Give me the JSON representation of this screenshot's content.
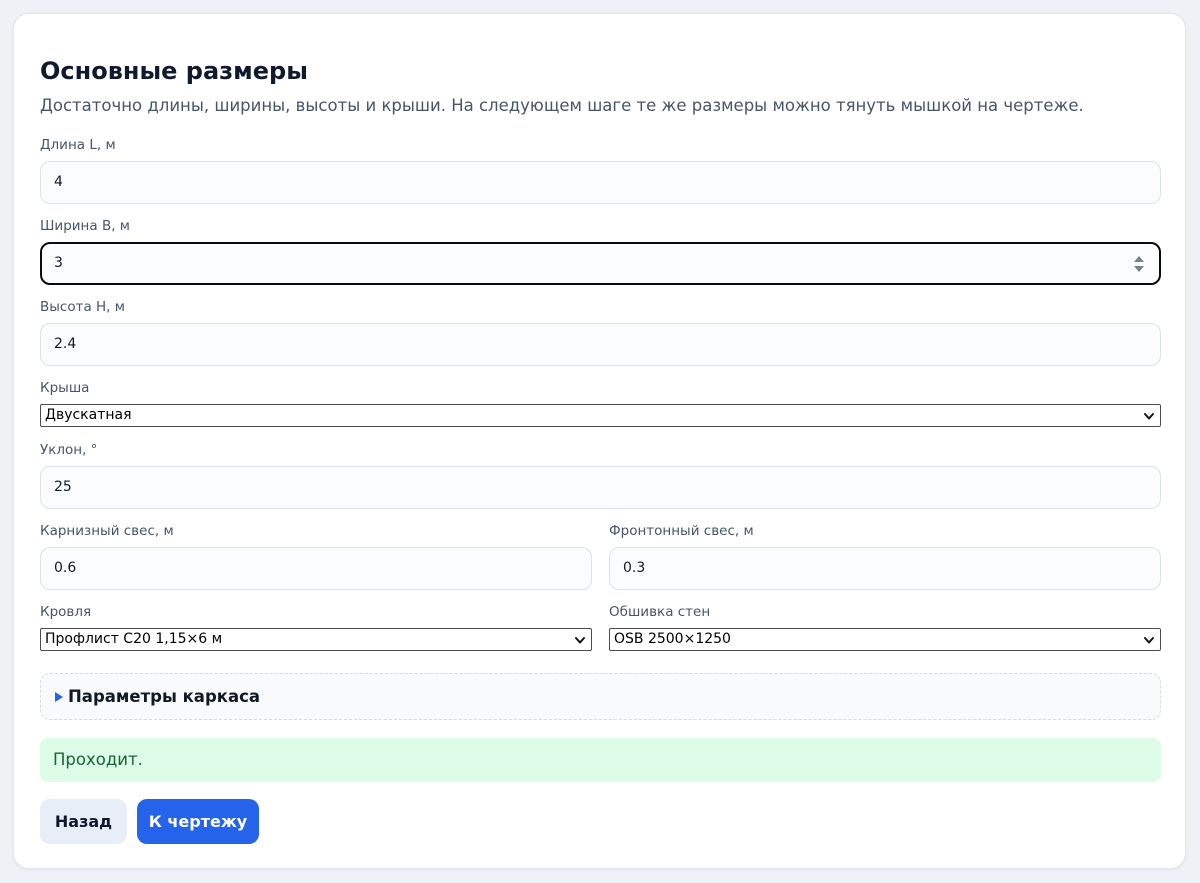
{
  "header": {
    "title": "Основные размеры",
    "subtitle": "Достаточно длины, ширины, высоты и крыши. На следующем шаге те же размеры можно тянуть мышкой на чертеже."
  },
  "fields": {
    "length": {
      "label": "Длина L, м",
      "value": "4"
    },
    "width": {
      "label": "Ширина B, м",
      "value": "3"
    },
    "height": {
      "label": "Высота H, м",
      "value": "2.4"
    },
    "roof": {
      "label": "Крыша",
      "value": "Двускатная"
    },
    "slope": {
      "label": "Уклон, °",
      "value": "25"
    },
    "eave_overhang": {
      "label": "Карнизный свес, м",
      "value": "0.6"
    },
    "gable_overhang": {
      "label": "Фронтонный свес, м",
      "value": "0.3"
    },
    "roofing": {
      "label": "Кровля",
      "value": "Профлист С20 1,15×6 м"
    },
    "wall_cladding": {
      "label": "Обшивка стен",
      "value": "OSB 2500×1250"
    }
  },
  "frame_section": {
    "label": "Параметры каркаса"
  },
  "status": {
    "text": "Проходит.",
    "color": "#166534",
    "background": "#dcfce7"
  },
  "actions": {
    "back_label": "Назад",
    "next_label": "К чертежу"
  },
  "colors": {
    "accent": "#2563eb",
    "focus_border": "#0b0b0b"
  },
  "icons": {
    "width_spinner": "spinner-icon",
    "select_chevron": "chevron-down-icon",
    "details_toggle": "triangle-right-icon"
  }
}
